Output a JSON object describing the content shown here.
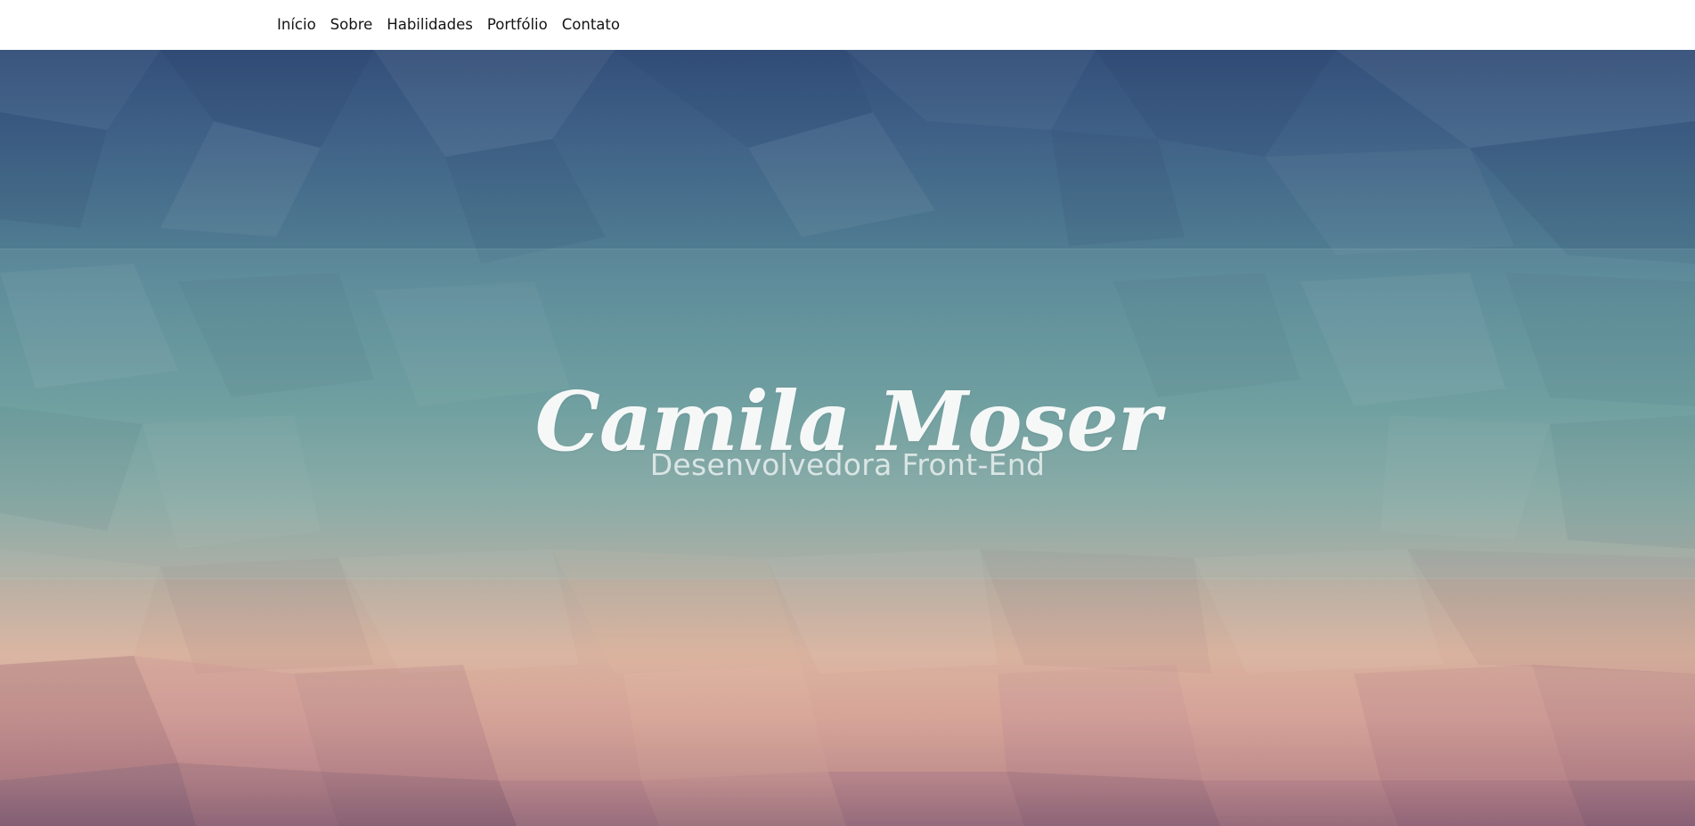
{
  "nav": {
    "items": [
      {
        "label": "Início"
      },
      {
        "label": "Sobre"
      },
      {
        "label": "Habilidades"
      },
      {
        "label": "Portfólio"
      },
      {
        "label": "Contato"
      }
    ]
  },
  "hero": {
    "name": "Camila Moser",
    "subtitle": "Desenvolvedora Front-End"
  },
  "colors": {
    "nav_bg": "#ffffff",
    "nav_text": "#141414",
    "hero_top": "#334f79",
    "hero_mid": "#6a9a9b",
    "hero_bottom": "#d9b29f",
    "hero_text": "#f6f8f8"
  }
}
